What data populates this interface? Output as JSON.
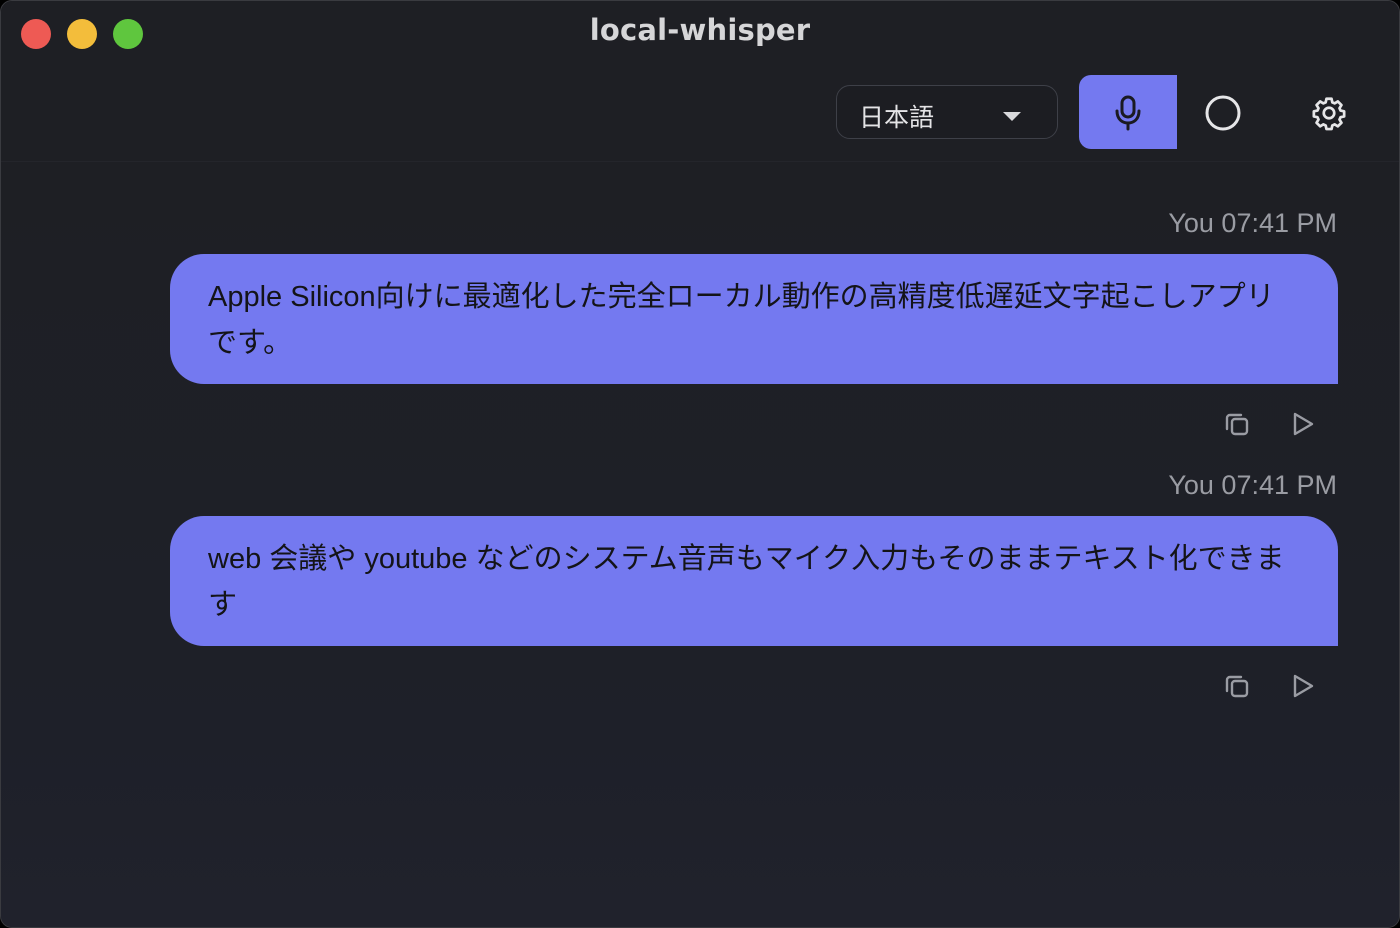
{
  "window": {
    "title": "local-whisper"
  },
  "toolbar": {
    "language_selected": "日本語",
    "icons": [
      "microphone-icon",
      "circle-icon",
      "gear-icon"
    ],
    "accent_color": "#7479f0"
  },
  "messages": [
    {
      "sender": "You",
      "time": "07:41 PM",
      "meta": "You 07:41 PM",
      "text": "Apple Silicon向けに最適化した完全ローカル動作の高精度低遅延文字起こしアプリです。"
    },
    {
      "sender": "You",
      "time": "07:41 PM",
      "meta": "You 07:41 PM",
      "text": "web 会議や youtube などのシステム音声もマイク入力もそのままテキスト化できます"
    }
  ],
  "message_action_icons": [
    "copy-icon",
    "play-icon"
  ]
}
